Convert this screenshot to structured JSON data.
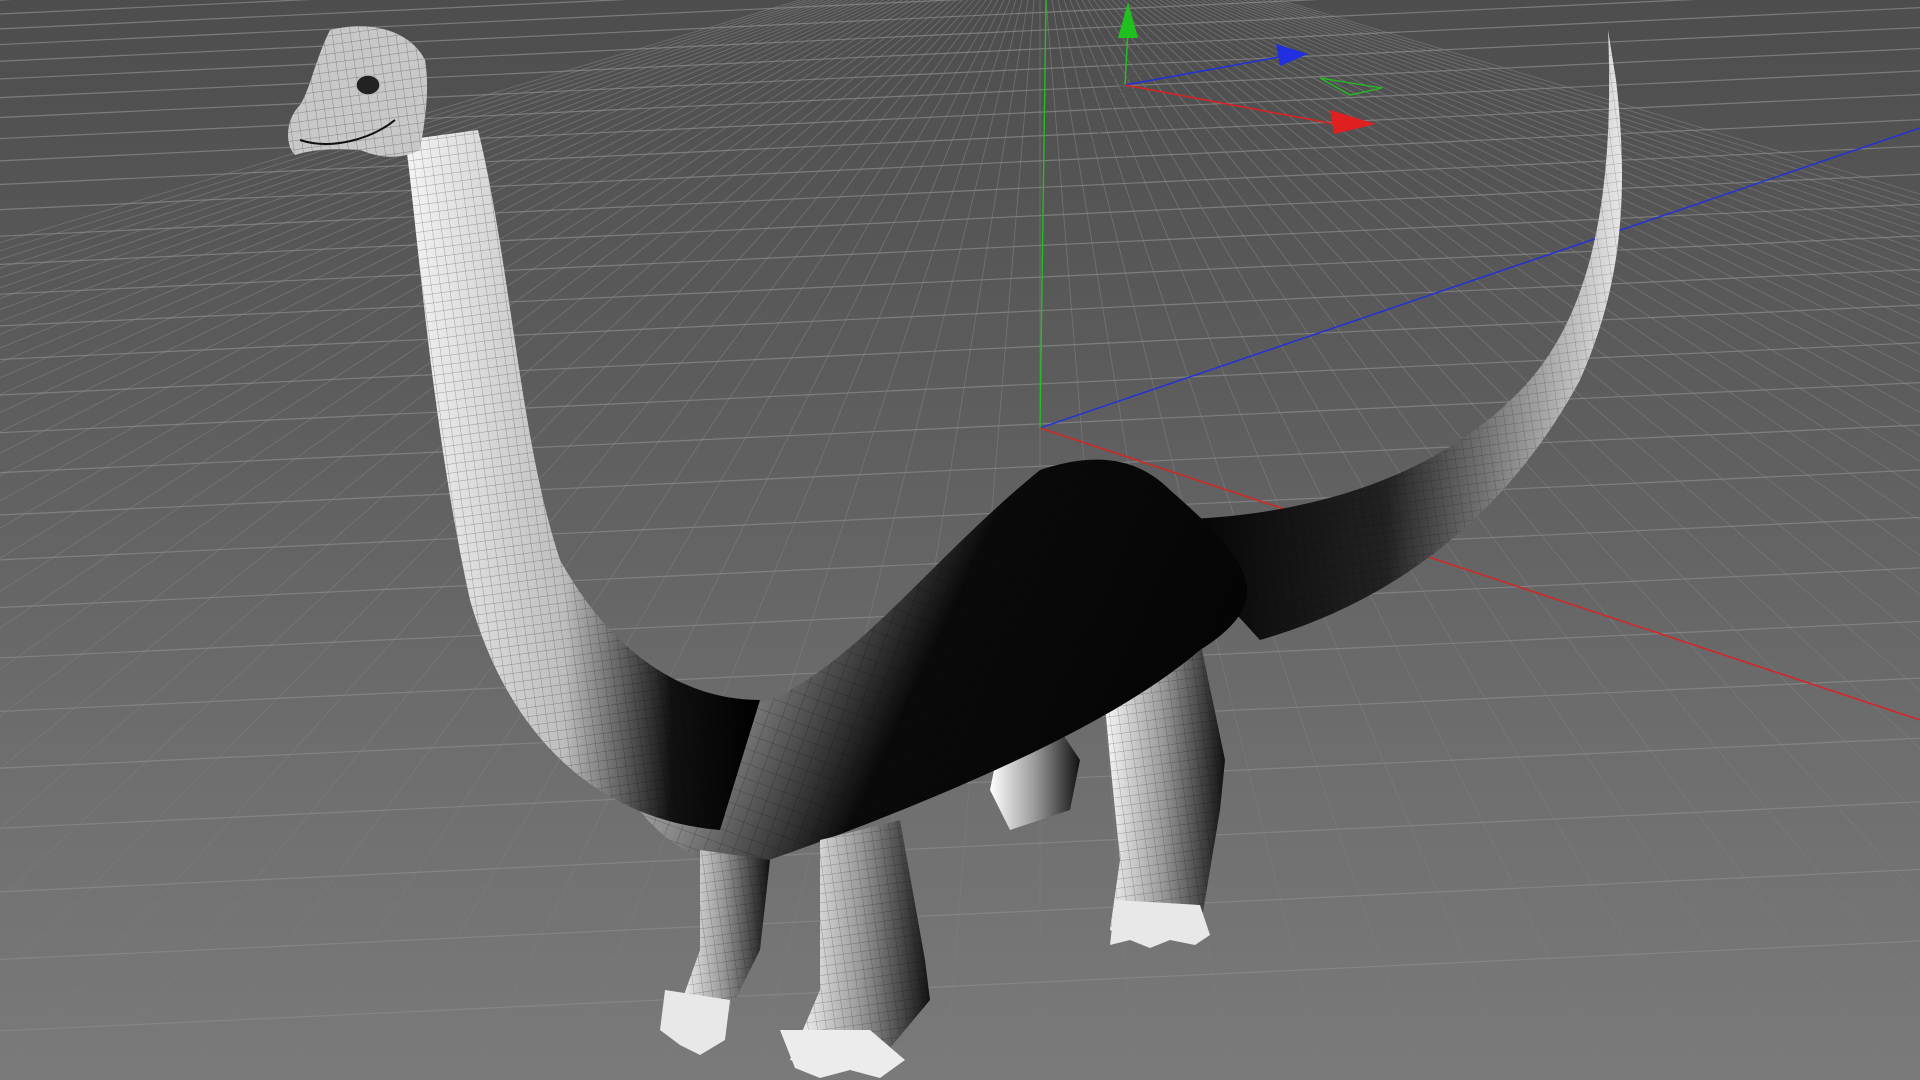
{
  "viewport": {
    "background_top": "#4d4d4d",
    "background_bottom": "#7a7a7a",
    "grid_color": "#8a8a8a"
  },
  "axes": {
    "x_color": "#e02020",
    "y_color": "#20c020",
    "z_color": "#2030e0"
  },
  "model": {
    "name_icon": "brachiosaurus-wireframe-model",
    "shading": "gouraud-with-wireframe"
  }
}
